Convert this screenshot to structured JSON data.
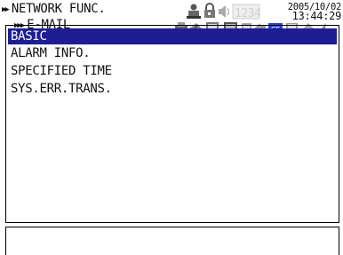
{
  "header": {
    "level1": "NETWORK FUNC.",
    "level2": "E-MAIL"
  },
  "status": {
    "counter": "1234",
    "date": "2005/10/02",
    "time": "13:44:29",
    "icons": [
      "user-lock-icon",
      "keylock-icon",
      "sound-icon",
      "printer-icon",
      "network-icon",
      "computer-icon",
      "display-icon",
      "arrow-icon",
      "cf-card-icon",
      "disk-icon",
      "ftp-icon",
      "email-icon"
    ]
  },
  "menu": {
    "items": [
      {
        "label": "BASIC",
        "selected": true
      },
      {
        "label": "ALARM INFO."
      },
      {
        "label": "SPECIFIED TIME"
      },
      {
        "label": "SYS.ERR.TRANS."
      }
    ]
  },
  "message": {
    "text": ""
  },
  "colors": {
    "highlight": "#1d1d94",
    "counter_inactive": "#d0d0d0"
  }
}
